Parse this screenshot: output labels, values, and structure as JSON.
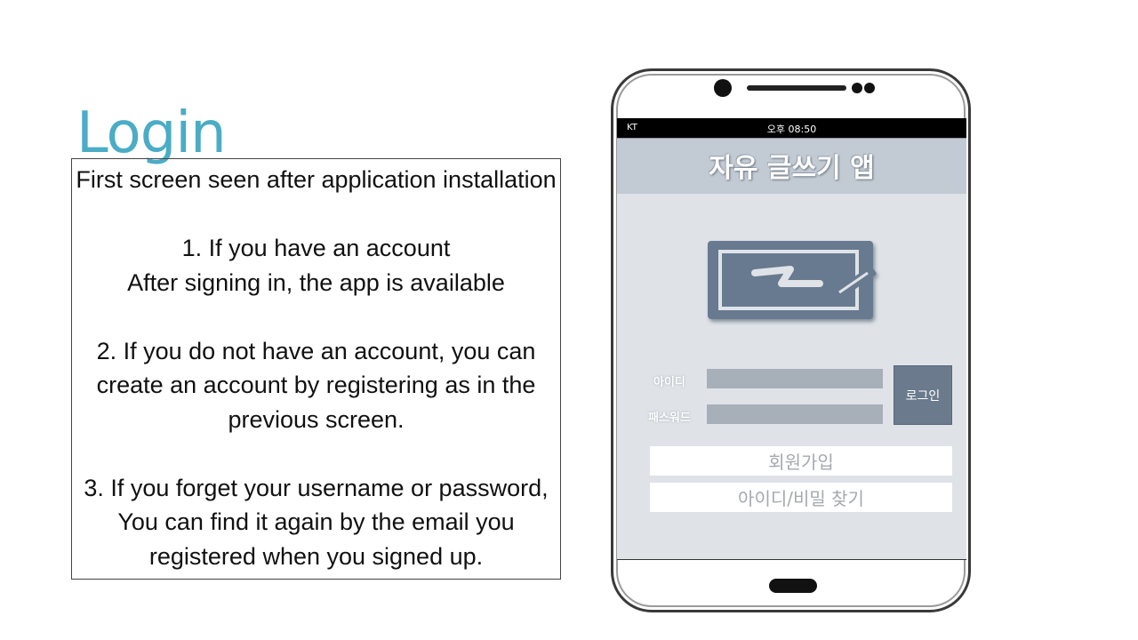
{
  "slide": {
    "title": "Login"
  },
  "description": {
    "intro": "First screen seen after application installation",
    "item1_line1": "1. If you have an account",
    "item1_line2": "After signing in, the app is available",
    "item2_line1": "2. If you do not have an account, you can",
    "item2_line2": "create an account by registering as in the",
    "item2_line3": "previous screen.",
    "item3_line1": "3. If you forget your username or password,",
    "item3_line2": "You can find it again by the email you",
    "item3_line3": "registered when you signed up."
  },
  "phone": {
    "status": {
      "carrier": "KT",
      "time": "오후 08:50"
    },
    "app_title": "자유 글쓰기 앱",
    "logo_icon": "battery-pen-logo-icon",
    "form": {
      "id_label": "아이디",
      "password_label": "패스워드",
      "id_value": "",
      "password_value": "",
      "login_button": "로그인"
    },
    "signup_button": "회원가입",
    "find_button": "아이디/비밀 찾기"
  },
  "colors": {
    "title": "#4bacc6",
    "app_header": "#c2cad3",
    "screen_bg": "#dfe3e8",
    "login_button": "#6b7a8d",
    "field": "#a7afb9"
  }
}
